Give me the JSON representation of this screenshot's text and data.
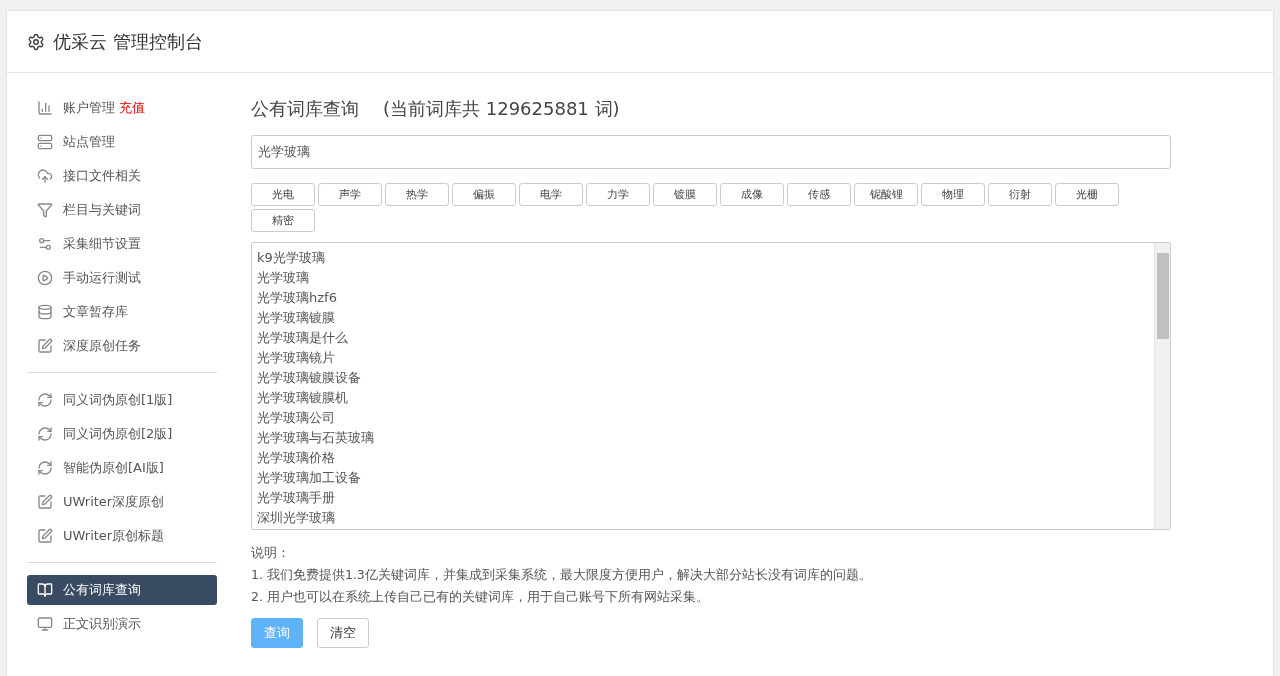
{
  "header": {
    "title": "优采云 管理控制台"
  },
  "sidebar": {
    "groups": [
      {
        "items": [
          {
            "label": "账户管理",
            "badge": "充值",
            "selected": false
          },
          {
            "label": "站点管理",
            "selected": false
          },
          {
            "label": "接口文件相关",
            "selected": false
          },
          {
            "label": "栏目与关键词",
            "selected": false
          },
          {
            "label": "采集细节设置",
            "selected": false
          },
          {
            "label": "手动运行测试",
            "selected": false
          },
          {
            "label": "文章暂存库",
            "selected": false
          },
          {
            "label": "深度原创任务",
            "selected": false
          }
        ]
      },
      {
        "items": [
          {
            "label": "同义词伪原创[1版]",
            "selected": false
          },
          {
            "label": "同义词伪原创[2版]",
            "selected": false
          },
          {
            "label": "智能伪原创[AI版]",
            "selected": false
          },
          {
            "label": "UWriter深度原创",
            "selected": false
          },
          {
            "label": "UWriter原创标题",
            "selected": false
          }
        ]
      },
      {
        "items": [
          {
            "label": "公有词库查询",
            "selected": true
          },
          {
            "label": "正文识别演示",
            "selected": false
          }
        ]
      }
    ]
  },
  "main": {
    "title": "公有词库查询",
    "count_text": "(当前词库共 129625881 词)",
    "search": {
      "value": "光学玻璃"
    },
    "tags": [
      "光电",
      "声学",
      "热学",
      "偏振",
      "电学",
      "力学",
      "镀膜",
      "成像",
      "传感",
      "铌酸锂",
      "物理",
      "衍射",
      "光栅",
      "精密"
    ],
    "results": [
      "k9光学玻璃",
      "光学玻璃",
      "光学玻璃hzf6",
      "光学玻璃镀膜",
      "光学玻璃是什么",
      "光学玻璃镜片",
      "光学玻璃镀膜设备",
      "光学玻璃镀膜机",
      "光学玻璃公司",
      "光学玻璃与石英玻璃",
      "光学玻璃价格",
      "光学玻璃加工设备",
      "光学玻璃手册",
      "深圳光学玻璃"
    ],
    "notes_title": "说明：",
    "notes": [
      "1. 我们免费提供1.3亿关键词库，并集成到采集系统，最大限度方便用户，解决大部分站长没有词库的问题。",
      "2. 用户也可以在系统上传自己已有的关键词库，用于自己账号下所有网站采集。"
    ],
    "buttons": [
      {
        "label": "查询",
        "kind": "primary"
      },
      {
        "label": "清空",
        "kind": "default"
      }
    ]
  }
}
